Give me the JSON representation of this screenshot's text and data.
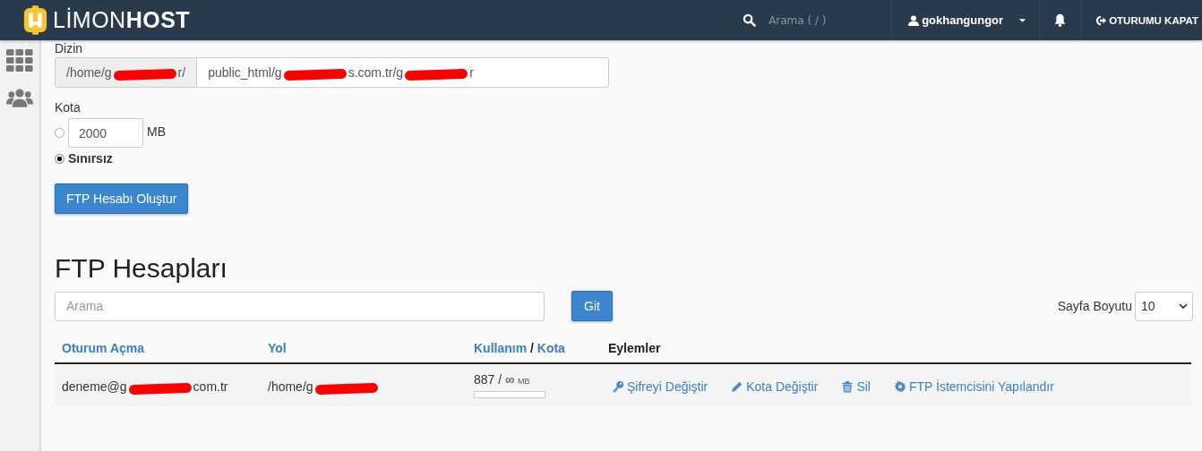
{
  "header": {
    "logo_light": "LİMON",
    "logo_bold": "HOST",
    "search": {
      "placeholder": "Arama ( / )"
    },
    "user": "gokhangungor",
    "logout": "OTURUMU KAPAT"
  },
  "form": {
    "directory_label": "Dizin",
    "directory_prefix": [
      {
        "kind": "text",
        "text": "/home/g"
      },
      {
        "kind": "redacted"
      },
      {
        "kind": "text",
        "text": "r/"
      }
    ],
    "directory_value": [
      {
        "kind": "text",
        "text": "public_html/g"
      },
      {
        "kind": "redacted"
      },
      {
        "kind": "text",
        "text": "s.com.tr/g"
      },
      {
        "kind": "redacted"
      },
      {
        "kind": "text",
        "text": "r"
      }
    ],
    "quota_label": "Kota",
    "quota_options": [
      {
        "kind": "amount",
        "value": "2000",
        "unit": "MB",
        "selected": false
      },
      {
        "kind": "label",
        "label": "Sınırsız",
        "selected": true
      }
    ],
    "submit": "FTP Hesabı Oluştur"
  },
  "accounts": {
    "title": "FTP Hesapları",
    "search": {
      "placeholder": "Arama"
    },
    "go": "Git",
    "page_size_label": "Sayfa Boyutu",
    "page_size": "10",
    "columns": [
      {
        "kind": "link",
        "label": "Oturum Açma"
      },
      {
        "kind": "link",
        "label": "Yol"
      },
      {
        "kind": "usage",
        "label": "Kullanım",
        "separator": "/",
        "label_2": "Kota"
      },
      {
        "kind": "plain",
        "label": "Eylemler"
      }
    ],
    "rows": [
      {
        "login": [
          {
            "kind": "text",
            "text": "deneme@g"
          },
          {
            "kind": "redacted"
          },
          {
            "kind": "text",
            "text": "com.tr"
          }
        ],
        "path": [
          {
            "kind": "text",
            "text": "/home/g"
          },
          {
            "kind": "redacted"
          }
        ],
        "usage": "887 /",
        "quota": "∞",
        "unit": "MB",
        "level": 0,
        "actions": [
          {
            "kind": "key",
            "label": "Şifreyi Değiştir"
          },
          {
            "kind": "pencil",
            "label": "Kota Değiştir"
          },
          {
            "kind": "trash",
            "label": "Sil"
          },
          {
            "kind": "gear",
            "label": "FTP İstemcisini Yapılandır"
          }
        ]
      }
    ]
  }
}
